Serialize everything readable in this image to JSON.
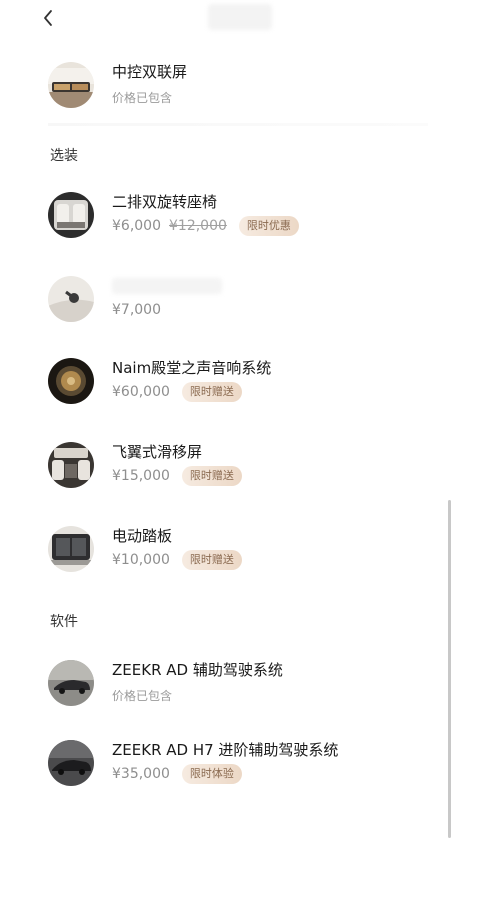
{
  "header": {
    "back_icon": "chevron-left-icon"
  },
  "included": [
    {
      "name": "中控双联屏",
      "note": "价格已包含"
    }
  ],
  "sections": {
    "options": "选装",
    "software": "软件"
  },
  "options": [
    {
      "name": "二排双旋转座椅",
      "price": "¥6,000",
      "old_price": "¥12,000",
      "badge": "限时优惠"
    },
    {
      "name": "",
      "price": "¥7,000"
    },
    {
      "name": "Naim殿堂之声音响系统",
      "price": "¥60,000",
      "badge": "限时赠送"
    },
    {
      "name": "飞翼式滑移屏",
      "price": "¥15,000",
      "badge": "限时赠送"
    },
    {
      "name": "电动踏板",
      "price": "¥10,000",
      "badge": "限时赠送"
    }
  ],
  "software": [
    {
      "name": "ZEEKR AD 辅助驾驶系统",
      "note": "价格已包含"
    },
    {
      "name": "ZEEKR AD H7 进阶辅助驾驶系统",
      "price": "¥35,000",
      "badge": "限时体验"
    }
  ],
  "colors": {
    "badge_text": "#8a6a50",
    "badge_bg": "#f0dfcf",
    "price_text": "#8e8e8e"
  }
}
